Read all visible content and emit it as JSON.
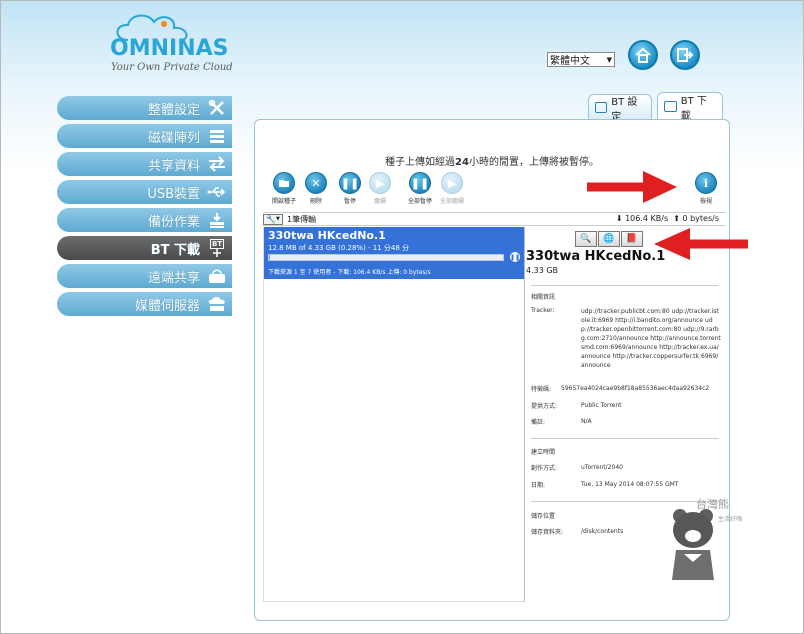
{
  "brand": {
    "name": "OMNINAS",
    "tagline": "Your Own Private Cloud"
  },
  "header": {
    "language": "繁體中文"
  },
  "sidebar": {
    "items": [
      {
        "label": "整體設定",
        "icon": "tools-icon"
      },
      {
        "label": "磁碟陣列",
        "icon": "disk-array-icon"
      },
      {
        "label": "共享資料",
        "icon": "share-arrows-icon"
      },
      {
        "label": "USB裝置",
        "icon": "usb-icon"
      },
      {
        "label": "備份作業",
        "icon": "backup-icon"
      },
      {
        "label": "BT 下載",
        "icon": "bt-icon",
        "badge": "BT",
        "active": true
      },
      {
        "label": "遠端共享",
        "icon": "remote-share-icon"
      },
      {
        "label": "媒體伺服器",
        "icon": "media-server-icon"
      }
    ]
  },
  "tabs": [
    {
      "label": "BT 設定"
    },
    {
      "label": "BT 下載",
      "active": true
    }
  ],
  "panel": {
    "notice_pre": "種子上傳如經過",
    "notice_bold": "24",
    "notice_post": "小時的閒置，上傳將被暫停。",
    "toolbar": {
      "open_seed": "開啟種子",
      "remove": "刪除",
      "pause": "暫停",
      "resume": "繼續",
      "pause_all": "全部暫停",
      "resume_all": "全部繼續",
      "info": "檢視"
    },
    "strip": {
      "count": "1筆傳輸",
      "down_speed": "106.4 KB/s",
      "up_speed": "0 bytes/s"
    },
    "torrent": {
      "name": "330twa HKcedNo.1",
      "progress_text": "12.8 MB of 4.33 GB (0.28%) - 11 分48 分",
      "progress_fraction": 0.0028,
      "peers": "下載來源 1 至 7 使用者 - 下載: 106.4 KB/s 上傳: 0 bytes/s"
    },
    "details": {
      "name": "330twa HKcedNo.1",
      "size": "4.33 GB",
      "section_related": "相關資訊",
      "tracker_label": "Tracker:",
      "tracker_value": "udp://tracker.publicbt.com:80 udp://tracker.istole.it:6969 http://i.bandito.org/announce udp://tracker.openbittorrent.com:80 udp://9.rarbg.com:2710/announce http://announce.torrentsmd.com:6969/announce http://tracker.ex.ua/announce http://tracker.coppersurfer.tk:6969/announce",
      "hash_label": "特徵碼:",
      "hash_value": "59657ea4024cae9b8f18a85536aec4daa92634c2",
      "provider_label": "提供方式:",
      "provider_value": "Public Torrent",
      "note_label": "備註:",
      "note_value": "N/A",
      "section_created": "建立時間",
      "creator_label": "創作方式:",
      "creator_value": "uTorrent/2040",
      "date_label": "日期:",
      "date_value": "Tue, 13 May 2014 08:07:55 GMT",
      "section_location": "儲存位置",
      "folder_label": "儲存資料夾:",
      "folder_value": "/disk/contents"
    }
  },
  "colors": {
    "accent": "#3472d8",
    "sidebar": "#5eaad2",
    "sidebar_active": "#4a4a4a",
    "arrow": "#e02020"
  }
}
